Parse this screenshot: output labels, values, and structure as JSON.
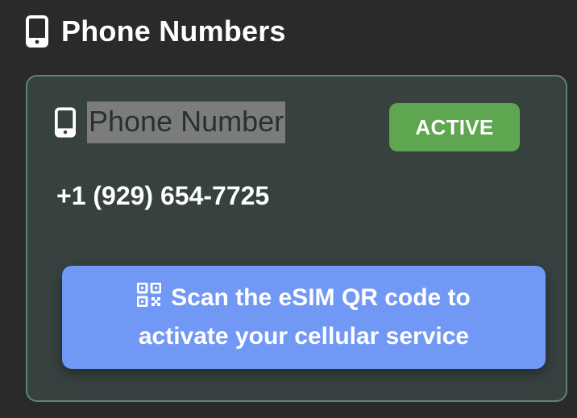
{
  "section": {
    "title": "Phone Numbers",
    "icon": "mobile-phone-icon"
  },
  "card": {
    "title": "Phone Number",
    "icon": "mobile-phone-icon",
    "status": "ACTIVE",
    "phone_number": "+1 (929) 654-7725",
    "notice": {
      "icon": "qr-code-icon",
      "line1": "Scan the eSIM QR code to",
      "line2": "activate your cellular service"
    }
  },
  "colors": {
    "background": "#2a2a2a",
    "card_background": "#364140",
    "card_border": "#5c827d",
    "status_active": "#5ea64f",
    "notice_background": "#7198f5"
  }
}
